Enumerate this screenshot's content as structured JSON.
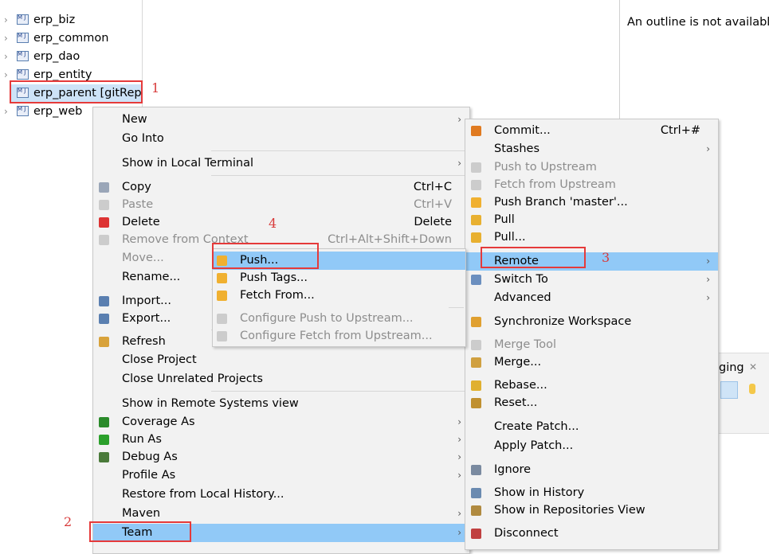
{
  "explorer": {
    "projects": [
      {
        "label": "erp_biz"
      },
      {
        "label": "erp_common"
      },
      {
        "label": "erp_dao"
      },
      {
        "label": "erp_entity"
      },
      {
        "label": "erp_parent [gitRep",
        "selected": true
      },
      {
        "label": "erp_web"
      }
    ]
  },
  "outline": {
    "message": "An outline is not available"
  },
  "staging": {
    "tab_label": "ging"
  },
  "context_menu": {
    "items": [
      {
        "label": "New",
        "submenu": true
      },
      {
        "label": "Go Into"
      },
      {
        "sep": true
      },
      {
        "label": "Show in Local Terminal",
        "submenu": true
      },
      {
        "sep": true
      },
      {
        "label": "Copy",
        "shortcut": "Ctrl+C",
        "icon": "copy-icon"
      },
      {
        "label": "Paste",
        "shortcut": "Ctrl+V",
        "disabled": true,
        "icon": "paste-icon"
      },
      {
        "label": "Delete",
        "shortcut": "Delete",
        "icon": "delete-icon"
      },
      {
        "label": "Remove from Context",
        "shortcut": "Ctrl+Alt+Shift+Down",
        "disabled": true,
        "icon": "remove-context-icon"
      },
      {
        "label": "Move...",
        "disabled": true
      },
      {
        "label": "Rename..."
      },
      {
        "sep": true
      },
      {
        "label": "Import...",
        "icon": "import-icon"
      },
      {
        "label": "Export...",
        "icon": "export-icon"
      },
      {
        "sep": true
      },
      {
        "label": "Refresh",
        "icon": "refresh-icon"
      },
      {
        "label": "Close Project"
      },
      {
        "label": "Close Unrelated Projects"
      },
      {
        "sep": true
      },
      {
        "label": "Show in Remote Systems view"
      },
      {
        "label": "Coverage As",
        "submenu": true,
        "icon": "coverage-icon"
      },
      {
        "label": "Run As",
        "submenu": true,
        "icon": "run-icon"
      },
      {
        "label": "Debug As",
        "submenu": true,
        "icon": "debug-icon"
      },
      {
        "label": "Profile As",
        "submenu": true
      },
      {
        "label": "Restore from Local History..."
      },
      {
        "label": "Maven",
        "submenu": true
      },
      {
        "label": "Team",
        "submenu": true,
        "highlighted": true
      }
    ]
  },
  "remote_menu": {
    "items": [
      {
        "label": "Push...",
        "highlighted": true,
        "icon": "push-icon"
      },
      {
        "label": "Push Tags...",
        "icon": "push-tags-icon"
      },
      {
        "label": "Fetch From...",
        "icon": "fetch-icon"
      },
      {
        "sep": true
      },
      {
        "label": "Configure Push to Upstream...",
        "disabled": true,
        "icon": "configure-push-icon"
      },
      {
        "label": "Configure Fetch from Upstream...",
        "disabled": true,
        "icon": "configure-fetch-icon"
      }
    ]
  },
  "team_menu": {
    "items": [
      {
        "label": "Commit...",
        "shortcut": "Ctrl+#",
        "icon": "commit-icon"
      },
      {
        "label": "Stashes",
        "submenu": true
      },
      {
        "label": "Push to Upstream",
        "disabled": true,
        "icon": "push-upstream-icon"
      },
      {
        "label": "Fetch from Upstream",
        "disabled": true,
        "icon": "fetch-upstream-icon"
      },
      {
        "label": "Push Branch 'master'...",
        "icon": "push-branch-icon"
      },
      {
        "label": "Pull",
        "icon": "pull-icon"
      },
      {
        "label": "Pull...",
        "icon": "pull-dialog-icon"
      },
      {
        "sep": true
      },
      {
        "label": "Remote",
        "submenu": true,
        "highlighted": true
      },
      {
        "label": "Switch To",
        "submenu": true,
        "icon": "switch-icon"
      },
      {
        "label": "Advanced",
        "submenu": true
      },
      {
        "sep": true
      },
      {
        "label": "Synchronize Workspace",
        "icon": "synchronize-icon"
      },
      {
        "sep": true
      },
      {
        "label": "Merge Tool",
        "disabled": true,
        "icon": "merge-tool-icon"
      },
      {
        "label": "Merge...",
        "icon": "merge-icon"
      },
      {
        "sep": true
      },
      {
        "label": "Rebase...",
        "icon": "rebase-icon"
      },
      {
        "label": "Reset...",
        "icon": "reset-icon"
      },
      {
        "sep": true
      },
      {
        "label": "Create Patch..."
      },
      {
        "label": "Apply Patch..."
      },
      {
        "sep": true
      },
      {
        "label": "Ignore",
        "icon": "ignore-icon"
      },
      {
        "sep": true
      },
      {
        "label": "Show in History",
        "icon": "history-icon"
      },
      {
        "label": "Show in Repositories View",
        "icon": "repositories-icon"
      },
      {
        "sep": true
      },
      {
        "label": "Disconnect",
        "icon": "disconnect-icon"
      }
    ]
  },
  "annotations": {
    "step1": "1",
    "step2": "2",
    "step3": "3",
    "step4": "4"
  },
  "colors": {
    "highlight": "#91c9f7",
    "annotation": "#e53a3a"
  }
}
